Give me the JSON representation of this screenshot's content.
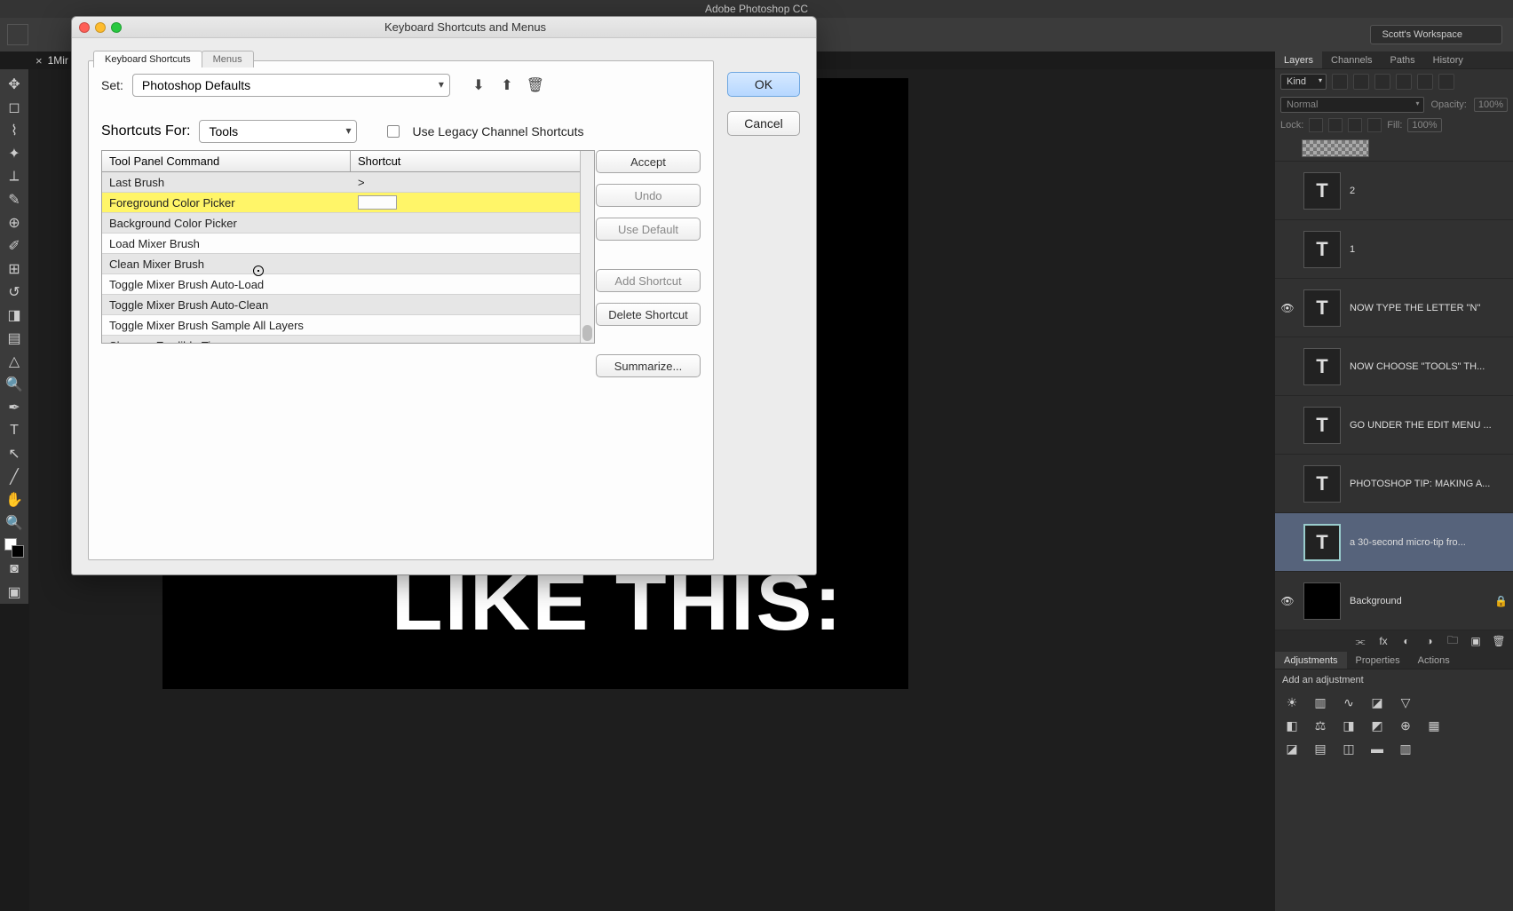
{
  "app_title": "Adobe Photoshop CC",
  "workspace": "Scott's Workspace",
  "doc_tab": "1Mir",
  "canvas_text": "LIKE THIS:",
  "dialog": {
    "title": "Keyboard Shortcuts and Menus",
    "tab_shortcuts": "Keyboard Shortcuts",
    "tab_menus": "Menus",
    "set_label": "Set:",
    "set_value": "Photoshop Defaults",
    "for_label": "Shortcuts For:",
    "for_value": "Tools",
    "legacy_label": "Use Legacy Channel Shortcuts",
    "col_cmd": "Tool Panel Command",
    "col_short": "Shortcut",
    "rows": [
      {
        "cmd": "Last Brush",
        "shortcut": ">"
      },
      {
        "cmd": "Foreground Color Picker",
        "shortcut": "",
        "selected": true
      },
      {
        "cmd": "Background Color Picker",
        "shortcut": ""
      },
      {
        "cmd": "Load Mixer Brush",
        "shortcut": ""
      },
      {
        "cmd": "Clean Mixer Brush",
        "shortcut": ""
      },
      {
        "cmd": "Toggle Mixer Brush Auto-Load",
        "shortcut": ""
      },
      {
        "cmd": "Toggle Mixer Brush Auto-Clean",
        "shortcut": ""
      },
      {
        "cmd": "Toggle Mixer Brush Sample All Layers",
        "shortcut": ""
      },
      {
        "cmd": "Sharpen Erodible Tips",
        "shortcut": ""
      }
    ],
    "btn_accept": "Accept",
    "btn_undo": "Undo",
    "btn_default": "Use Default",
    "btn_add": "Add Shortcut",
    "btn_delete": "Delete Shortcut",
    "btn_summarize": "Summarize...",
    "btn_ok": "OK",
    "btn_cancel": "Cancel"
  },
  "panel_tabs": {
    "layers": "Layers",
    "channels": "Channels",
    "paths": "Paths",
    "history": "History"
  },
  "kind_label": "Kind",
  "blend_mode": "Normal",
  "opacity_label": "Opacity:",
  "opacity_value": "100%",
  "lock_label": "Lock:",
  "fill_label": "Fill:",
  "fill_value": "100%",
  "layers": [
    {
      "name": "2",
      "icon": "T"
    },
    {
      "name": "1",
      "icon": "T"
    },
    {
      "name": "NOW TYPE THE LETTER \"N\"",
      "icon": "T",
      "visible": true
    },
    {
      "name": "NOW CHOOSE \"TOOLS\"   TH...",
      "icon": "T"
    },
    {
      "name": "GO UNDER THE EDIT MENU ...",
      "icon": "T"
    },
    {
      "name": "PHOTOSHOP TIP: MAKING A...",
      "icon": "T"
    },
    {
      "name": "a 30-second micro-tip fro...",
      "icon": "T",
      "selected": true
    },
    {
      "name": "Background",
      "bg": true,
      "visible": true,
      "locked": true
    }
  ],
  "adjust_tabs": {
    "adjustments": "Adjustments",
    "properties": "Properties",
    "actions": "Actions"
  },
  "adjust_header": "Add an adjustment"
}
